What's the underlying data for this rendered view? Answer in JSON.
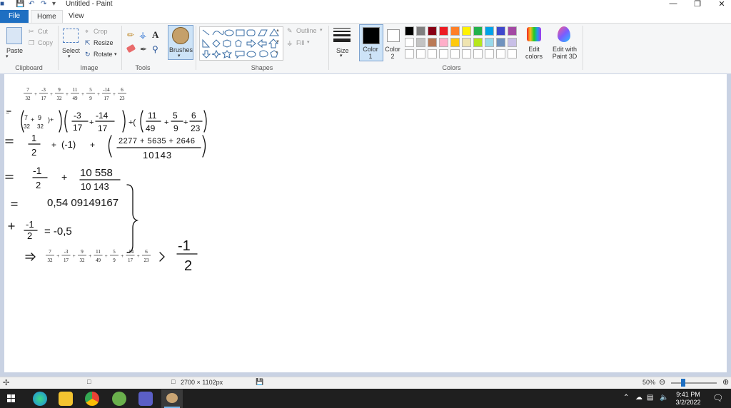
{
  "window": {
    "title": "Untitled - Paint"
  },
  "tabs": {
    "file": "File",
    "home": "Home",
    "view": "View"
  },
  "clipboard": {
    "paste": "Paste",
    "cut": "Cut",
    "copy": "Copy",
    "label": "Clipboard"
  },
  "image": {
    "select": "Select",
    "crop": "Crop",
    "resize": "Resize",
    "rotate": "Rotate",
    "label": "Image"
  },
  "tools": {
    "label": "Tools",
    "text_tool": "A"
  },
  "brushes": {
    "label": "Brushes"
  },
  "shapes": {
    "outline": "Outline",
    "fill": "Fill",
    "label": "Shapes"
  },
  "size": {
    "label": "Size"
  },
  "colors": {
    "color1_label": "Color 1",
    "color2_label": "Color 2",
    "edit_colors": "Edit colors",
    "paint3d": "Edit with Paint 3D",
    "label": "Colors",
    "palette_row1": [
      "#000000",
      "#7f7f7f",
      "#880015",
      "#ed1c24",
      "#ff7f27",
      "#fff200",
      "#22b14c",
      "#00a2e8",
      "#3f48cc",
      "#a349a4"
    ],
    "palette_row2": [
      "#ffffff",
      "#c3c3c3",
      "#b97a57",
      "#ffaec9",
      "#ffc90e",
      "#efe4b0",
      "#b5e61d",
      "#99d9ea",
      "#7092be",
      "#c8bfe7"
    ],
    "palette_row3": [
      "#ffffff",
      "#ffffff",
      "#ffffff",
      "#ffffff",
      "#ffffff",
      "#ffffff",
      "#ffffff",
      "#ffffff",
      "#ffffff",
      "#ffffff"
    ]
  },
  "math": {
    "line1": [
      "7/32",
      "-3/17",
      "9/32",
      "11/49",
      "5/9",
      "-14/17",
      "6/23"
    ],
    "line2_groups": [
      "7/32 + 9/32",
      "-3/17 + -14/17",
      "11/49 + 5/9 + 6/23"
    ],
    "line3": {
      "a": "1/2",
      "b": "(-1)",
      "num": "2277 + 5635 + 2646",
      "den": "10143"
    },
    "line4": {
      "a": "-1/2",
      "num": "10 558",
      "den": "10 143"
    },
    "line5": "0,54 09149167",
    "line6": {
      "frac": "-1/2",
      "rhs": "= -0,5"
    },
    "conclusion": "> -1/2"
  },
  "status": {
    "dimensions": "2700 × 1102px",
    "zoom": "50%"
  },
  "taskbar": {
    "time": "9:41 PM",
    "date": "3/2/2022"
  }
}
